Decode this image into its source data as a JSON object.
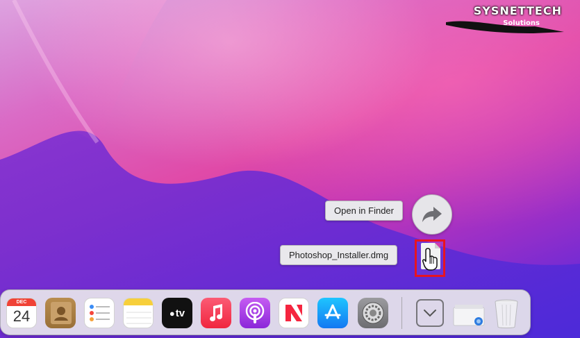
{
  "watermark": {
    "brand": "SYSNETTECH",
    "tagline": "Solutions"
  },
  "stack_popup": {
    "open_in_finder_label": "Open in Finder",
    "file_label": "Photoshop_Installer.dmg",
    "highlight_color": "#e8141f"
  },
  "dock": {
    "items": [
      {
        "name": "Calendar",
        "month": "DEC",
        "day": "24"
      },
      {
        "name": "Contacts"
      },
      {
        "name": "Reminders"
      },
      {
        "name": "Notes"
      },
      {
        "name": "Apple TV",
        "glyph": "tv"
      },
      {
        "name": "Music"
      },
      {
        "name": "Podcasts"
      },
      {
        "name": "News"
      },
      {
        "name": "App Store"
      },
      {
        "name": "System Preferences"
      },
      {
        "name": "Downloads"
      },
      {
        "name": "Preview"
      },
      {
        "name": "Trash"
      }
    ]
  }
}
